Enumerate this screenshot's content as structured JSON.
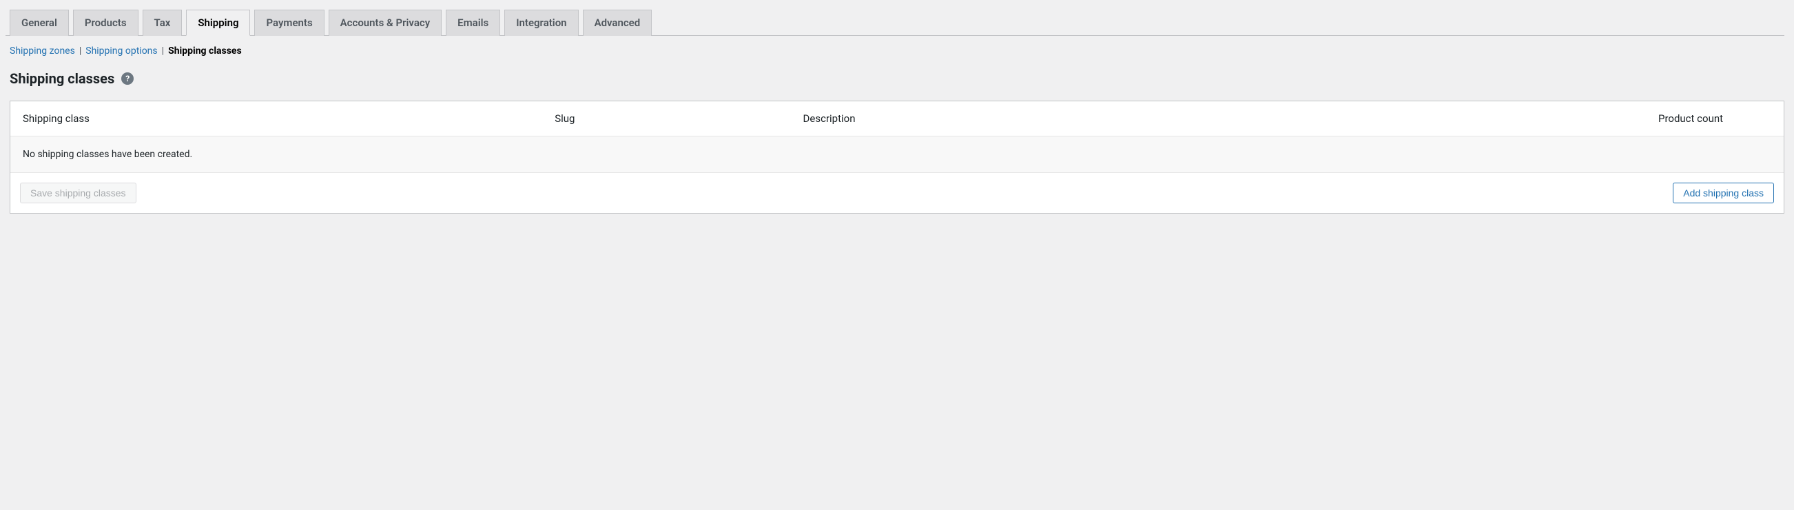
{
  "tabs": {
    "general": "General",
    "products": "Products",
    "tax": "Tax",
    "shipping": "Shipping",
    "payments": "Payments",
    "accounts_privacy": "Accounts & Privacy",
    "emails": "Emails",
    "integration": "Integration",
    "advanced": "Advanced"
  },
  "subnav": {
    "zones": "Shipping zones",
    "options": "Shipping options",
    "classes": "Shipping classes"
  },
  "page": {
    "title": "Shipping classes",
    "help_symbol": "?"
  },
  "table": {
    "headers": {
      "name": "Shipping class",
      "slug": "Slug",
      "description": "Description",
      "count": "Product count"
    },
    "empty": "No shipping classes have been created."
  },
  "buttons": {
    "save": "Save shipping classes",
    "add": "Add shipping class"
  }
}
